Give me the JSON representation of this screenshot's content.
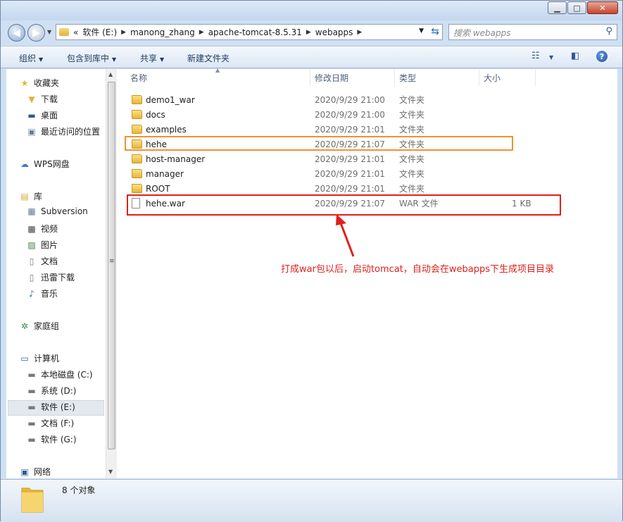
{
  "address": {
    "overflow": "«",
    "crumbs": [
      "软件 (E:)",
      "manong_zhang",
      "apache-tomcat-8.5.31",
      "webapps"
    ],
    "search_placeholder": "搜索 webapps"
  },
  "toolbar": {
    "organize": "组织",
    "include_in_library": "包含到库中",
    "share": "共享",
    "new_folder": "新建文件夹"
  },
  "nav": {
    "favorites": "收藏夹",
    "downloads": "下载",
    "desktop": "桌面",
    "recent": "最近访问的位置",
    "wps": "WPS网盘",
    "libraries": "库",
    "subversion": "Subversion",
    "videos": "视频",
    "pictures": "图片",
    "documents": "文档",
    "xunlei": "迅雷下载",
    "music": "音乐",
    "homegroup": "家庭组",
    "computer": "计算机",
    "drive_c": "本地磁盘 (C:)",
    "drive_d": "系统 (D:)",
    "drive_e": "软件 (E:)",
    "drive_f": "文档 (F:)",
    "drive_g": "软件 (G:)",
    "network": "网络"
  },
  "columns": {
    "name": "名称",
    "date": "修改日期",
    "type": "类型",
    "size": "大小"
  },
  "files": [
    {
      "name": "demo1_war",
      "date": "2020/9/29 21:00",
      "type": "文件夹",
      "size": ""
    },
    {
      "name": "docs",
      "date": "2020/9/29 21:00",
      "type": "文件夹",
      "size": ""
    },
    {
      "name": "examples",
      "date": "2020/9/29 21:01",
      "type": "文件夹",
      "size": ""
    },
    {
      "name": "hehe",
      "date": "2020/9/29 21:07",
      "type": "文件夹",
      "size": ""
    },
    {
      "name": "host-manager",
      "date": "2020/9/29 21:01",
      "type": "文件夹",
      "size": ""
    },
    {
      "name": "manager",
      "date": "2020/9/29 21:01",
      "type": "文件夹",
      "size": ""
    },
    {
      "name": "ROOT",
      "date": "2020/9/29 21:01",
      "type": "文件夹",
      "size": ""
    },
    {
      "name": "hehe.war",
      "date": "2020/9/29 21:07",
      "type": "WAR 文件",
      "size": "1 KB"
    }
  ],
  "annotation": "打成war包以后，启动tomcat，自动会在webapps下生成项目目录",
  "status": {
    "count": "8 个对象"
  },
  "colors": {
    "highlight_orange": "#f0922e",
    "highlight_red": "#e0201a"
  }
}
